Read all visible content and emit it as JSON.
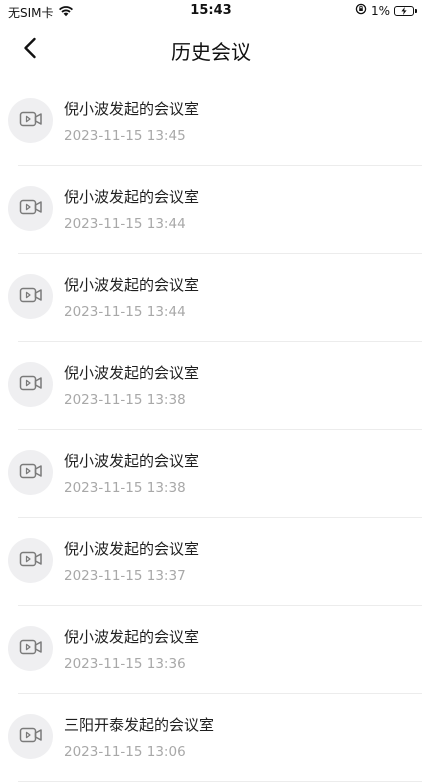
{
  "status_bar": {
    "carrier": "无SIM卡",
    "time": "15:43",
    "battery": "1%"
  },
  "nav": {
    "title": "历史会议",
    "back_icon": "chevron-left-icon"
  },
  "meetings": [
    {
      "title": "倪小波发起的会议室",
      "time": "2023-11-15 13:45"
    },
    {
      "title": "倪小波发起的会议室",
      "time": "2023-11-15 13:44"
    },
    {
      "title": "倪小波发起的会议室",
      "time": "2023-11-15 13:44"
    },
    {
      "title": "倪小波发起的会议室",
      "time": "2023-11-15 13:38"
    },
    {
      "title": "倪小波发起的会议室",
      "time": "2023-11-15 13:38"
    },
    {
      "title": "倪小波发起的会议室",
      "time": "2023-11-15 13:37"
    },
    {
      "title": "倪小波发起的会议室",
      "time": "2023-11-15 13:36"
    },
    {
      "title": "三阳开泰发起的会议室",
      "time": "2023-11-15 13:06"
    }
  ],
  "colors": {
    "title_text": "#1f1f1f",
    "time_text": "#a8a8a8",
    "avatar_bg": "#efeff1",
    "divider": "#ececec"
  }
}
